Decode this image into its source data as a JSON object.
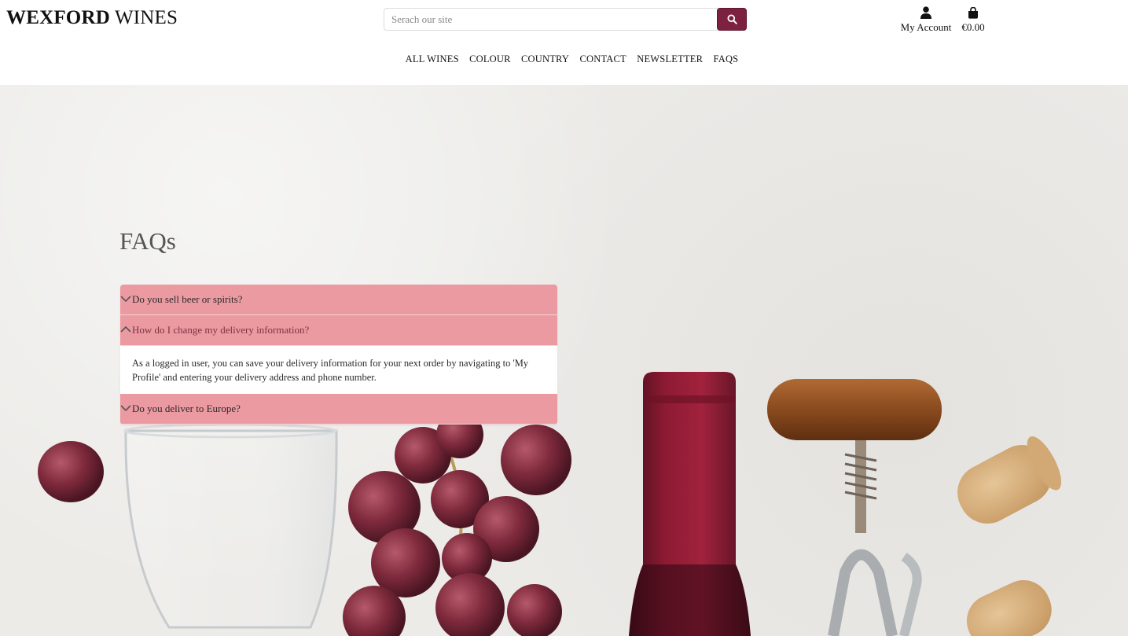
{
  "brand": {
    "bold": "WEXFORD",
    "light": "WINES"
  },
  "search": {
    "placeholder": "Serach our site",
    "button_icon": "search-icon"
  },
  "account": {
    "label": "My Account",
    "icon": "user-icon"
  },
  "cart": {
    "label": "€0.00",
    "icon": "shopping-bag-icon"
  },
  "nav": [
    "ALL WINES",
    "COLOUR",
    "COUNTRY",
    "CONTACT",
    "NEWSLETTER",
    "FAQS"
  ],
  "page": {
    "title": "FAQs"
  },
  "faqs": [
    {
      "question": "Do you sell beer or spirits?",
      "open": false
    },
    {
      "question": "How do I change my delivery information?",
      "open": true,
      "answer": "As a logged in user, you can save your delivery information for your next order by navigating to 'My Profile' and entering your delivery address and phone number."
    },
    {
      "question": "Do you deliver to Europe?",
      "open": false
    }
  ],
  "colors": {
    "accent": "#7c2140",
    "accordion": "#ec9aa2",
    "background": "#ecebe8"
  }
}
